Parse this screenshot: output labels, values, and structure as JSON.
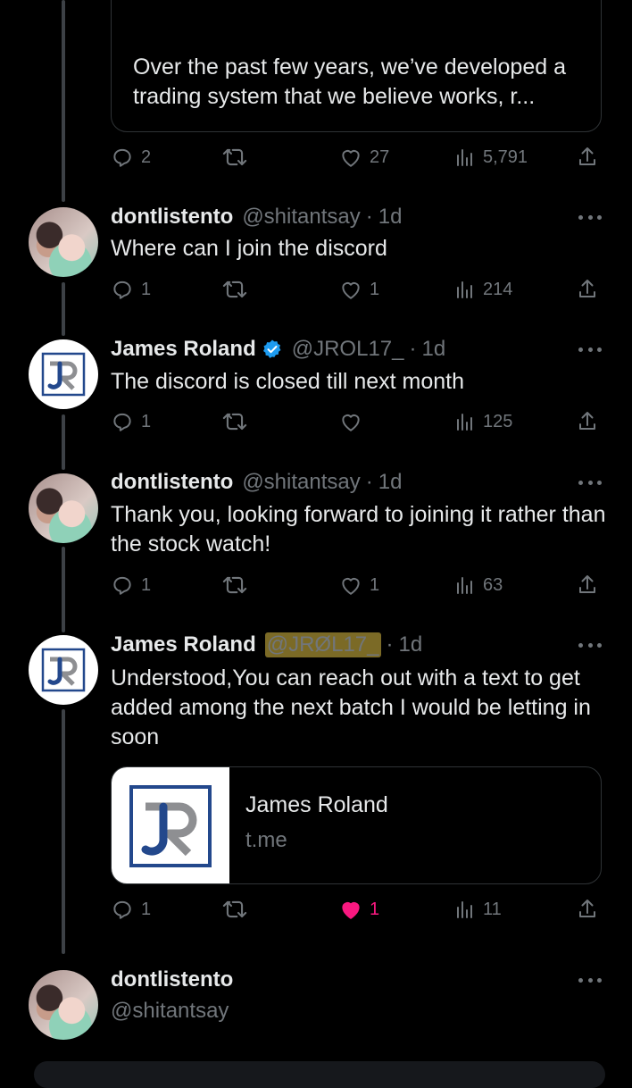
{
  "colors": {
    "background": "#000000",
    "text": "#e7e9ea",
    "muted": "#71767b",
    "verified": "#1d9bf0",
    "liked": "#f91880",
    "highlight": "#e0c146"
  },
  "quote": {
    "text": "Over the past few years, we’ve developed a trading system that we believe works, r..."
  },
  "quote_actions": {
    "replies": "2",
    "likes": "27",
    "views": "5,791"
  },
  "tweets": [
    {
      "name": "dontlistento",
      "handle": "@shitantsay",
      "dot": "·",
      "time": "1d",
      "body": "Where can I join the discord",
      "replies": "1",
      "likes": "1",
      "views": "214"
    },
    {
      "name": "James Roland",
      "handle": "@JROL17_",
      "dot": "·",
      "time": "1d",
      "body": "The discord is closed till next month",
      "replies": "1",
      "likes": "",
      "views": "125"
    },
    {
      "name": "dontlistento",
      "handle": "@shitantsay",
      "dot": "·",
      "time": "1d",
      "body": "Thank you, looking forward to joining it rather than the stock watch!",
      "replies": "1",
      "likes": "1",
      "views": "63"
    },
    {
      "name": "James Roland",
      "handle": "@JRØL17_",
      "dot": "·",
      "time": "1d",
      "body": "Understood,You can reach out with a text to get added among the next batch I would be letting in soon",
      "replies": "1",
      "likes": "1",
      "views": "11"
    }
  ],
  "card": {
    "title": "James Roland",
    "domain": "t.me"
  },
  "composer": {
    "name": "dontlistento",
    "handle": "@shitantsay"
  },
  "icons": {
    "reply": "reply-icon",
    "retweet": "retweet-icon",
    "like": "heart-icon",
    "views": "views-icon",
    "share": "share-icon",
    "more": "more-icon",
    "verified": "verified-badge-icon"
  }
}
